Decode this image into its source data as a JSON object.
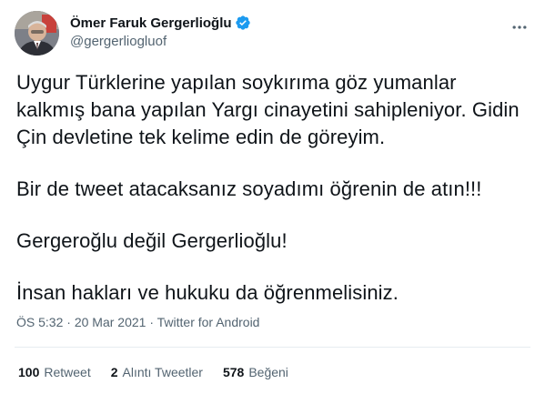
{
  "author": {
    "display_name": "Ömer Faruk Gergerlioğlu",
    "handle": "@gergerliogluof",
    "verified": true
  },
  "tweet": {
    "paragraphs": [
      "Uygur Türklerine yapılan soykırıma göz yumanlar kalkmış bana yapılan Yargı cinayetini sahipleniyor. Gidin Çin devletine tek kelime edin de göreyim.",
      "Bir de tweet atacaksanız soyadımı öğrenin de atın!!!",
      "Gergeroğlu değil Gergerlioğlu!",
      "İnsan hakları ve hukuku da öğrenmelisiniz."
    ],
    "time": "ÖS 5:32",
    "date": "20 Mar 2021",
    "separator": "·",
    "source": "Twitter for Android"
  },
  "stats": {
    "retweets": {
      "count": "100",
      "label": "Retweet"
    },
    "quotes": {
      "count": "2",
      "label": "Alıntı Tweetler"
    },
    "likes": {
      "count": "578",
      "label": "Beğeni"
    }
  },
  "colors": {
    "text": "#0f1419",
    "secondary": "#536471",
    "verified": "#1d9bf0",
    "divider": "#e6ecf0"
  },
  "icons": {
    "more": "more-horizontal-icon",
    "verified": "verified-badge-icon"
  }
}
